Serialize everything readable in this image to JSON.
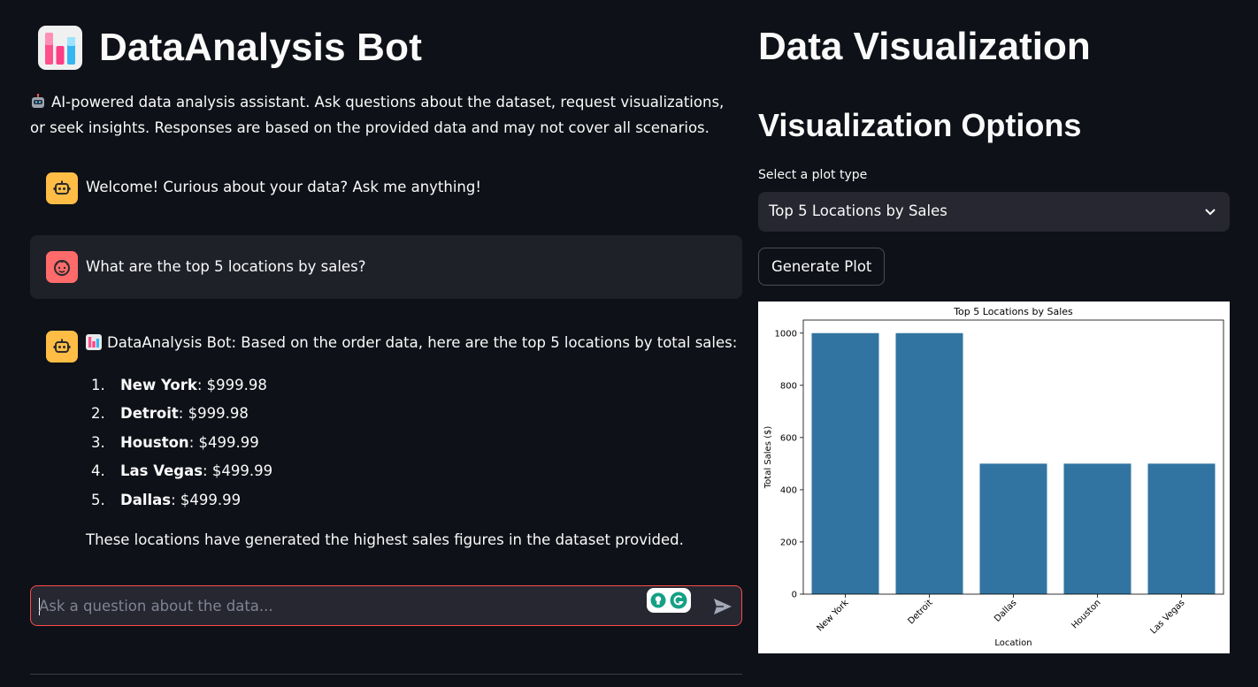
{
  "app": {
    "title": "DataAnalysis Bot",
    "intro": "AI-powered data analysis assistant. Ask questions about the dataset, request visualizations, or seek insights. Responses are based on the provided data and may not cover all scenarios."
  },
  "chat": {
    "messages": [
      {
        "role": "assistant",
        "text": "Welcome! Curious about your data? Ask me anything!"
      },
      {
        "role": "user",
        "text": "What are the top 5 locations by sales?"
      },
      {
        "role": "assistant",
        "intro": "DataAnalysis Bot: Based on the order data, here are the top 5 locations by total sales:",
        "items": [
          {
            "num": "1.",
            "name": "New York",
            "value": ": $999.98"
          },
          {
            "num": "2.",
            "name": "Detroit",
            "value": ": $999.98"
          },
          {
            "num": "3.",
            "name": "Houston",
            "value": ": $499.99"
          },
          {
            "num": "4.",
            "name": "Las Vegas",
            "value": ": $499.99"
          },
          {
            "num": "5.",
            "name": "Dallas",
            "value": ": $499.99"
          }
        ],
        "outro": "These locations have generated the highest sales figures in the dataset provided."
      }
    ],
    "input_placeholder": "Ask a question about the data..."
  },
  "viz": {
    "title": "Data Visualization",
    "subtitle": "Visualization Options",
    "select_label": "Select a plot type",
    "selected": "Top 5 Locations by Sales",
    "generate_label": "Generate Plot"
  },
  "colors": {
    "accent": "#ff4b4b",
    "bar": "#3274a1",
    "bot_avatar": "#ffbd45",
    "user_avatar": "#ff6b6b"
  },
  "chart_data": {
    "type": "bar",
    "title": "Top 5 Locations by Sales",
    "xlabel": "Location",
    "ylabel": "Total Sales ($)",
    "categories": [
      "New York",
      "Detroit",
      "Dallas",
      "Houston",
      "Las Vegas"
    ],
    "values": [
      999.98,
      999.98,
      499.99,
      499.99,
      499.99
    ],
    "yticks": [
      0,
      200,
      400,
      600,
      800,
      1000
    ],
    "ylim": [
      0,
      1050
    ],
    "grid": false
  }
}
